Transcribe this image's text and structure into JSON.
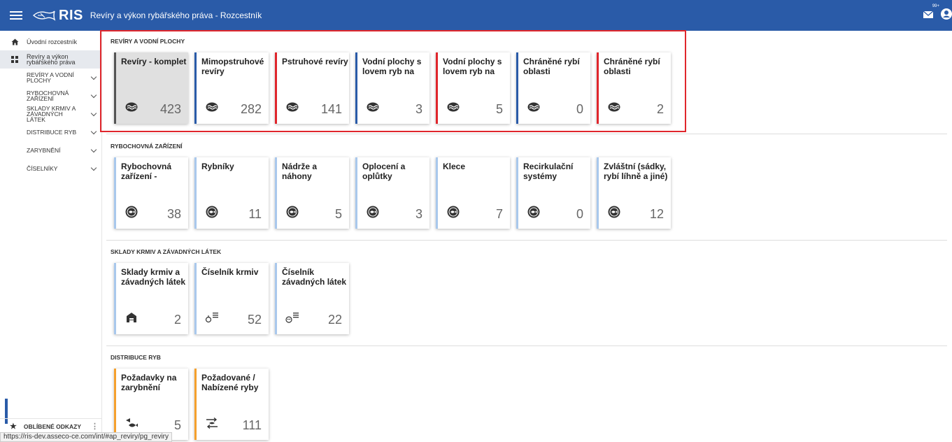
{
  "header": {
    "logo_text": "RIS",
    "app_title": "Revíry a výkon rybářského práva - Rozcestník",
    "mail_badge": "99+"
  },
  "sidebar": {
    "items": [
      {
        "label": "Úvodní rozcestník",
        "icon": "home-icon"
      },
      {
        "label": "Revíry a výkon rybářského práva",
        "icon": "grid-icon"
      }
    ],
    "subitems": [
      {
        "label": "REVÍRY A VODNÍ PLOCHY"
      },
      {
        "label": "RYBOCHOVNÁ ZAŘÍZENÍ"
      },
      {
        "label": "SKLADY KRMIV A ZÁVADNÝCH LÁTEK"
      },
      {
        "label": "DISTRIBUCE RYB"
      },
      {
        "label": "ZARYBNĚNÍ"
      },
      {
        "label": "ČÍSELNÍKY"
      }
    ],
    "favorites_label": "OBLÍBENÉ ODKAZY"
  },
  "status_url": "https://ris-dev.asseco-ce.com/int/#ap_reviry/pg_reviry",
  "sections": [
    {
      "title": "REVÍRY A VODNÍ PLOCHY",
      "cards": [
        {
          "title": "Revíry - komplet",
          "count": "423",
          "accent": "#555555",
          "icon": "water-icon"
        },
        {
          "title": "Mimopstruhové revíry",
          "count": "282",
          "accent": "#2a5ba8",
          "icon": "water-icon"
        },
        {
          "title": "Pstruhové revíry",
          "count": "141",
          "accent": "#e0262c",
          "icon": "water-icon"
        },
        {
          "title": "Vodní plochy s lovem ryb na",
          "count": "3",
          "accent": "#2a5ba8",
          "icon": "water-icon"
        },
        {
          "title": "Vodní plochy s lovem ryb na",
          "count": "5",
          "accent": "#e0262c",
          "icon": "water-icon"
        },
        {
          "title": "Chráněné rybí oblasti",
          "count": "0",
          "accent": "#2a5ba8",
          "icon": "water-icon"
        },
        {
          "title": "Chráněné rybí oblasti",
          "count": "2",
          "accent": "#e0262c",
          "icon": "water-icon"
        }
      ]
    },
    {
      "title": "RYBOCHOVNÁ ZAŘÍZENÍ",
      "cards": [
        {
          "title": "Rybochovná zařízení -",
          "count": "38",
          "icon": "fish-farm-icon"
        },
        {
          "title": "Rybníky",
          "count": "11",
          "icon": "fish-farm-icon"
        },
        {
          "title": "Nádrže a náhony",
          "count": "5",
          "icon": "fish-farm-icon"
        },
        {
          "title": "Oplocení a oplůtky",
          "count": "3",
          "icon": "fish-farm-icon"
        },
        {
          "title": "Klece",
          "count": "7",
          "icon": "fish-farm-icon"
        },
        {
          "title": "Recirkulační systémy",
          "count": "0",
          "icon": "fish-farm-icon"
        },
        {
          "title": "Zvláštní (sádky, rybí líhně a jiné)",
          "count": "12",
          "icon": "fish-farm-icon"
        }
      ]
    },
    {
      "title": "SKLADY KRMIV A ZÁVADNÝCH LÁTEK",
      "cards": [
        {
          "title": "Sklady krmiv a závadných látek",
          "count": "2",
          "icon": "warehouse-icon"
        },
        {
          "title": "Číselník krmiv",
          "count": "52",
          "icon": "feed-list-icon"
        },
        {
          "title": "Číselník závadných látek",
          "count": "22",
          "icon": "hazard-list-icon"
        }
      ]
    },
    {
      "title": "DISTRIBUCE RYB",
      "cards": [
        {
          "title": "Požadavky na zarybnění",
          "count": "5",
          "icon": "fish-request-icon"
        },
        {
          "title": "Požadované / Nabízené ryby",
          "count": "111",
          "icon": "fish-exchange-icon"
        }
      ]
    }
  ]
}
